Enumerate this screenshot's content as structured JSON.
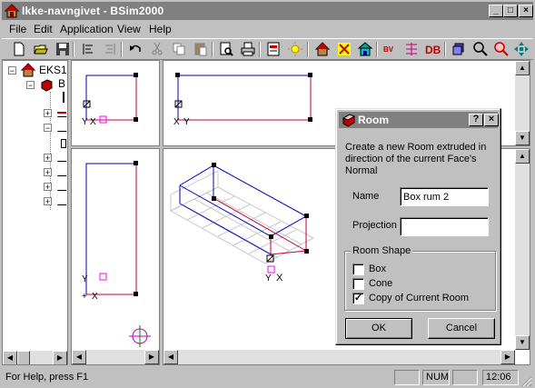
{
  "window": {
    "title": "Ikke-navngivet - BSim2000"
  },
  "title_buttons": {
    "minimize": "_",
    "maximize": "□",
    "close": "×"
  },
  "menu": [
    {
      "label": "File",
      "key": "F"
    },
    {
      "label": "Edit",
      "key": "E"
    },
    {
      "label": "Application",
      "key": "A"
    },
    {
      "label": "View",
      "key": "V"
    },
    {
      "label": "Help",
      "key": "H"
    }
  ],
  "toolbar": {
    "icons": [
      "new-icon",
      "open-icon",
      "save-icon",
      "align-left-icon",
      "align-right-icon",
      "undo-icon",
      "cut-icon",
      "copy-icon",
      "paste-icon",
      "print-preview-icon",
      "print-icon",
      "doc-icon",
      "sun-icon",
      "house-icon",
      "cross-icon",
      "building-icon",
      "bv-icon",
      "graph-icon",
      "db-icon",
      "cube-icon",
      "zoom-icon",
      "zoom-alt-icon",
      "move-icon"
    ],
    "db_label": "DB",
    "bv_label": "BV"
  },
  "tree": {
    "root_label": "EKS1",
    "child_label": "B"
  },
  "dialog": {
    "title": "Room",
    "help_btn": "?",
    "close_btn": "×",
    "description": "Create a new Room extruded in direction of the current Face's Normal",
    "name_label": "Name",
    "name_value": "Box rum 2",
    "projection_label": "Projection",
    "projection_value": "",
    "group_label": "Room Shape",
    "options": [
      {
        "label": "Box",
        "checked": false
      },
      {
        "label": "Cone",
        "checked": false
      },
      {
        "label": "Copy of Current Room",
        "checked": true
      }
    ],
    "ok_label": "OK",
    "cancel_label": "Cancel"
  },
  "statusbar": {
    "help_text": "For Help, press F1",
    "num": "NUM",
    "time": "12:06"
  },
  "colors": {
    "titlebar": "#808080",
    "accent_blue": "#0000c0",
    "accent_red": "#c00040",
    "grid": "#c8c8c8",
    "magenta": "#ff00ff"
  }
}
